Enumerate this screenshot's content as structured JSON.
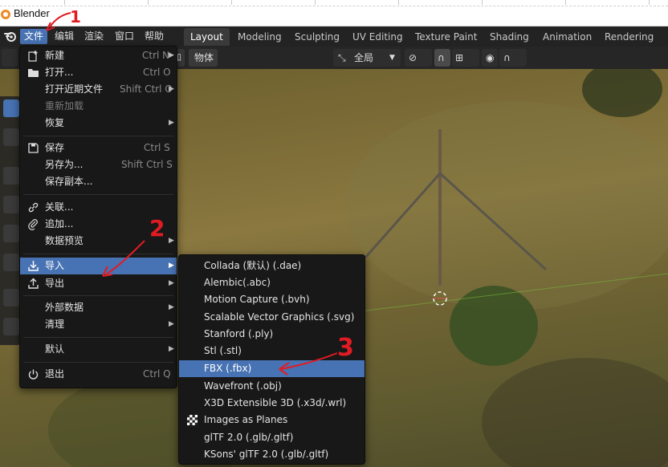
{
  "window": {
    "title": "Blender"
  },
  "topbar": {
    "menus": [
      "文件",
      "编辑",
      "渲染",
      "窗口",
      "帮助"
    ],
    "workspaces": [
      "Layout",
      "Modeling",
      "Sculpting",
      "UV Editing",
      "Texture Paint",
      "Shading",
      "Animation",
      "Rendering"
    ],
    "active_menu": "文件",
    "active_workspace": "Layout"
  },
  "viewport_header": {
    "orientation": "全局",
    "object_label": "物体",
    "object_prefix": "加"
  },
  "file_menu": {
    "items": [
      {
        "label": "新建",
        "shortcut": "Ctrl N",
        "submenu": true,
        "icon": "new-file-icon"
      },
      {
        "label": "打开...",
        "shortcut": "Ctrl O",
        "icon": "folder-icon"
      },
      {
        "label": "打开近期文件",
        "shortcut": "Shift Ctrl O",
        "submenu": true
      },
      {
        "label": "重新加载",
        "disabled": true
      },
      {
        "label": "恢复",
        "submenu": true
      },
      {
        "label": "保存",
        "shortcut": "Ctrl S",
        "icon": "save-icon"
      },
      {
        "label": "另存为...",
        "shortcut": "Shift Ctrl S"
      },
      {
        "label": "保存副本..."
      },
      {
        "label": "关联...",
        "icon": "link-icon"
      },
      {
        "label": "追加...",
        "icon": "append-icon"
      },
      {
        "label": "数据预览",
        "submenu": true
      },
      {
        "label": "导入",
        "submenu": true,
        "icon": "import-icon",
        "highlighted": true
      },
      {
        "label": "导出",
        "submenu": true,
        "icon": "export-icon"
      },
      {
        "label": "外部数据",
        "submenu": true
      },
      {
        "label": "清理",
        "submenu": true
      },
      {
        "label": "默认",
        "submenu": true
      },
      {
        "label": "退出",
        "shortcut": "Ctrl Q",
        "icon": "quit-icon"
      }
    ]
  },
  "import_menu": {
    "items": [
      {
        "label": "Collada (默认) (.dae)"
      },
      {
        "label": "Alembic(.abc)"
      },
      {
        "label": "Motion Capture (.bvh)"
      },
      {
        "label": "Scalable Vector Graphics (.svg)"
      },
      {
        "label": "Stanford (.ply)"
      },
      {
        "label": "Stl (.stl)"
      },
      {
        "label": "FBX (.fbx)",
        "highlighted": true
      },
      {
        "label": "Wavefront (.obj)"
      },
      {
        "label": "X3D Extensible 3D (.x3d/.wrl)"
      },
      {
        "label": "Images as Planes",
        "icon": "checker-icon"
      },
      {
        "label": "glTF 2.0 (.glb/.gltf)"
      },
      {
        "label": "KSons' glTF 2.0 (.glb/.gltf)"
      }
    ]
  },
  "annotations": {
    "step1": "1",
    "step2": "2",
    "step3": "3"
  },
  "colors": {
    "highlight": "#4772b3",
    "menu_bg": "#181818",
    "annotation": "#e21b23"
  }
}
